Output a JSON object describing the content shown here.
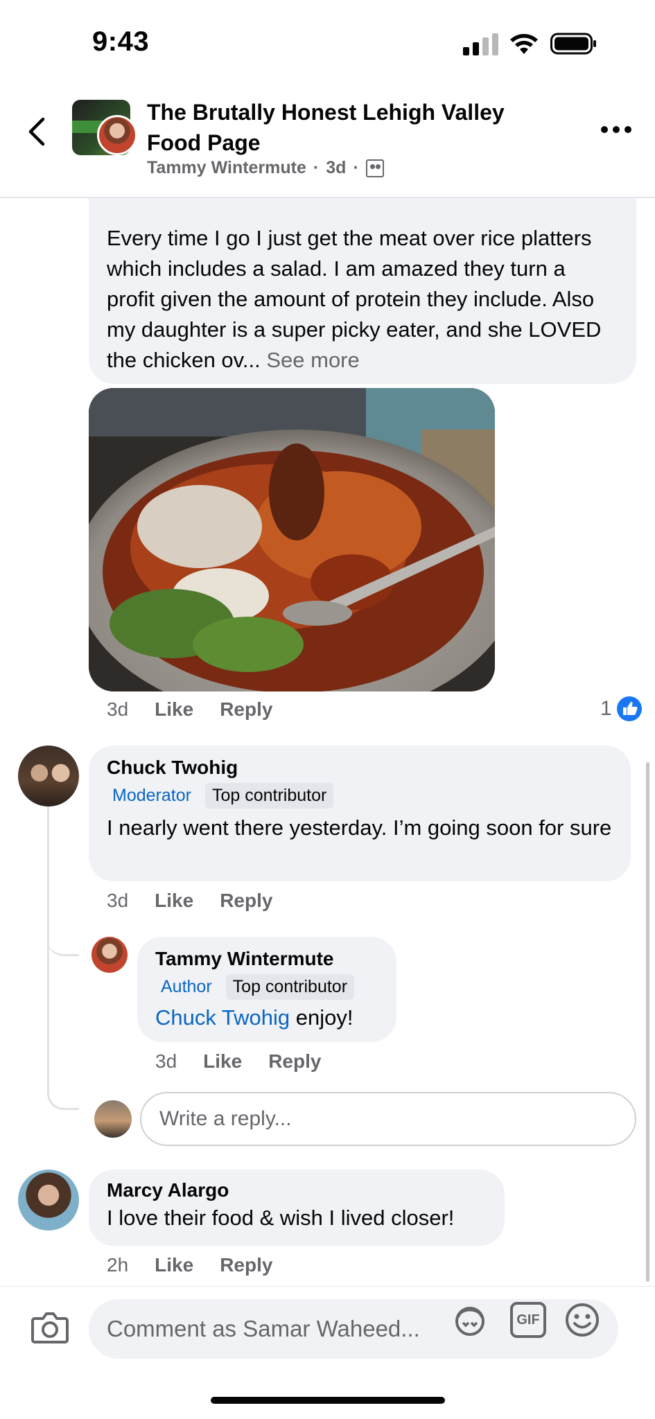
{
  "status_bar": {
    "time": "9:43"
  },
  "header": {
    "group_name": "The Brutally Honest Lehigh Valley Food Page",
    "author": "Tammy Wintermute",
    "age": "3d",
    "separator": "·"
  },
  "post_comment": {
    "text": "Every time I go I just get the meat over rice platters which includes a salad. I am amazed they turn a profit given the amount of protein they include. Also my daughter is a super picky eater, and she LOVED the chicken ov...",
    "see_more": "See more",
    "time": "3d",
    "like": "Like",
    "reply": "Reply",
    "reaction_count": "1"
  },
  "comments": [
    {
      "name": "Chuck Twohig",
      "badge_role": "Moderator",
      "badge_contrib": "Top contributor",
      "text": "I nearly went there yesterday.  I’m going soon for sure",
      "time": "3d",
      "like": "Like",
      "reply": "Reply"
    },
    {
      "name": "Tammy Wintermute",
      "badge_role": "Author",
      "badge_contrib": "Top contributor",
      "mention": "Chuck Twohig",
      "text": " enjoy!",
      "time": "3d",
      "like": "Like",
      "reply": "Reply"
    },
    {
      "name": "Marcy Alargo",
      "text": "I love their food & wish I lived closer!",
      "time": "2h",
      "like": "Like",
      "reply": "Reply"
    }
  ],
  "reply_input": {
    "placeholder": "Write a reply..."
  },
  "comment_bar": {
    "placeholder": "Comment as Samar Waheed...",
    "gif_label": "GIF"
  },
  "colors": {
    "link_blue": "#0a66c2",
    "like_blue": "#1877f2",
    "bubble_gray": "#f0f2f5",
    "meta_gray": "#65676b"
  }
}
